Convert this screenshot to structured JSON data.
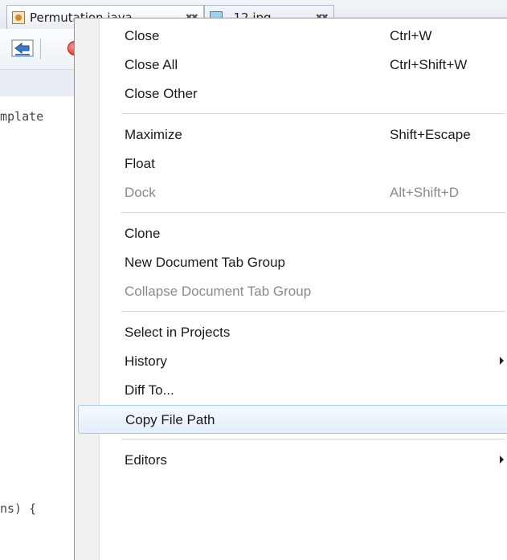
{
  "tabs": [
    {
      "label": "Permutation.java",
      "close": "✖✖"
    },
    {
      "label": "_12.jpg",
      "close": "✖✖"
    }
  ],
  "code": {
    "line1": "mplate",
    "line2": "ns) {"
  },
  "menu": {
    "groups": [
      [
        {
          "label": "Close",
          "shortcut": "Ctrl+W"
        },
        {
          "label": "Close All",
          "shortcut": "Ctrl+Shift+W"
        },
        {
          "label": "Close Other",
          "shortcut": ""
        }
      ],
      [
        {
          "label": "Maximize",
          "shortcut": "Shift+Escape"
        },
        {
          "label": "Float",
          "shortcut": ""
        },
        {
          "label": "Dock",
          "shortcut": "Alt+Shift+D",
          "disabled": true
        }
      ],
      [
        {
          "label": "Clone",
          "shortcut": ""
        },
        {
          "label": "New Document Tab Group",
          "shortcut": ""
        },
        {
          "label": "Collapse Document Tab Group",
          "shortcut": "",
          "disabled": true
        }
      ],
      [
        {
          "label": "Select in Projects",
          "shortcut": ""
        },
        {
          "label": "History",
          "shortcut": "",
          "submenu": true
        },
        {
          "label": "Diff To...",
          "shortcut": ""
        },
        {
          "label": "Copy File Path",
          "shortcut": "",
          "highlighted": true
        }
      ],
      [
        {
          "label": "Editors",
          "shortcut": "",
          "submenu": true
        }
      ]
    ]
  },
  "colors": {
    "highlight_border": "#a9c9ee",
    "disabled_text": "#8a8a8a",
    "record_button": "#d7261c"
  }
}
